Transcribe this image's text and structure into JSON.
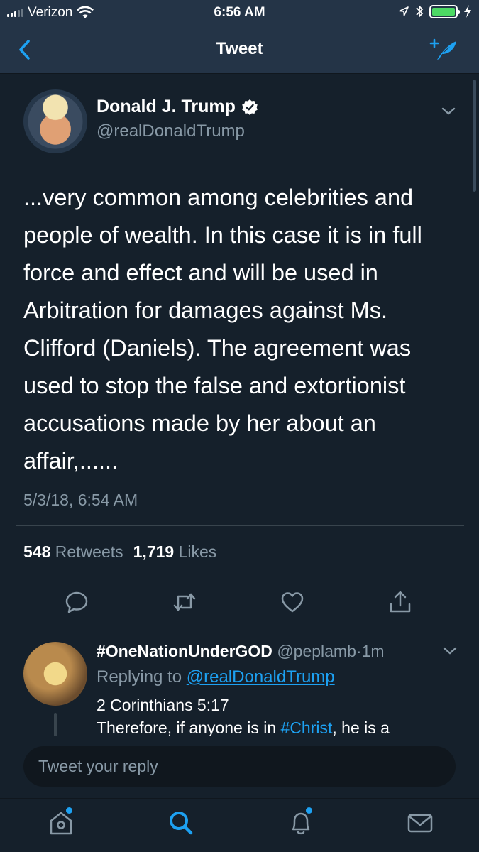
{
  "status_bar": {
    "carrier": "Verizon",
    "time": "6:56 AM",
    "icons": [
      "signal-icon",
      "wifi-icon",
      "location-icon",
      "bluetooth-icon",
      "battery-icon",
      "charging-icon"
    ]
  },
  "nav": {
    "title": "Tweet",
    "back_icon": "chevron-left-icon",
    "compose_icon": "compose-tweet-icon"
  },
  "tweet": {
    "author_name": "Donald J. Trump",
    "author_handle": "@realDonaldTrump",
    "verified": true,
    "text": "...very common among celebrities and people of wealth. In this case it is in full force and effect and will be used in Arbitration for damages against Ms. Clifford (Daniels). The agreement was used to stop the false and extortionist accusations made by her about an affair,......",
    "text_lines": [
      "...very common among celebrities and",
      "people of wealth. In this case it is in full",
      "force and effect and will be used in",
      "Arbitration for damages against Ms.",
      "Clifford (Daniels). The agreement was",
      "used to stop the false and extortionist",
      "accusations made by her about an",
      "affair,......"
    ],
    "timestamp": "5/3/18, 6:54 AM",
    "retweets_count": "548",
    "retweets_label": "Retweets",
    "likes_count": "1,719",
    "likes_label": "Likes",
    "actions": [
      "reply-icon",
      "retweet-icon",
      "like-icon",
      "share-icon"
    ]
  },
  "reply": {
    "name": "#OneNationUnderGOD",
    "handle": "@peplamb",
    "separator": "·",
    "age": "1m",
    "replying_prefix": "Replying to",
    "replying_to": "@realDonaldTrump",
    "line1": "2 Corinthians 5:17",
    "line2_pre": "Therefore, if anyone is in ",
    "line2_tag": "#Christ",
    "line2_post": ", he is a"
  },
  "compose": {
    "placeholder": "Tweet your reply"
  },
  "tab_bar": {
    "tabs": [
      "home-icon",
      "search-icon",
      "notifications-icon",
      "messages-icon"
    ],
    "active": "search-icon"
  },
  "colors": {
    "background": "#15202b",
    "bar": "#243447",
    "accent": "#1da1f2",
    "secondary_text": "#8899a6",
    "divider": "#38444d"
  }
}
